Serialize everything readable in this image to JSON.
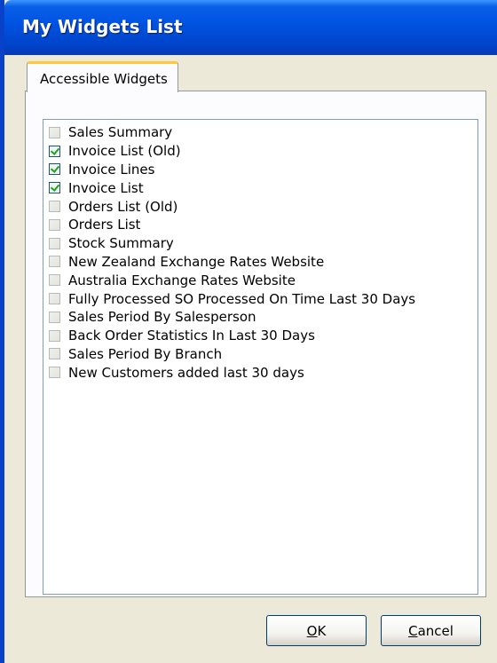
{
  "window": {
    "title": "My Widgets List"
  },
  "tabs": [
    {
      "label": "Accessible Widgets"
    }
  ],
  "widgets": [
    {
      "label": "Sales Summary",
      "checked": false
    },
    {
      "label": "Invoice List (Old)",
      "checked": true
    },
    {
      "label": "Invoice Lines",
      "checked": true
    },
    {
      "label": "Invoice List",
      "checked": true
    },
    {
      "label": "Orders List (Old)",
      "checked": false
    },
    {
      "label": "Orders List",
      "checked": false
    },
    {
      "label": "Stock Summary",
      "checked": false
    },
    {
      "label": "New Zealand Exchange Rates Website",
      "checked": false
    },
    {
      "label": "Australia Exchange Rates Website",
      "checked": false
    },
    {
      "label": "Fully Processed SO Processed On Time Last 30 Days",
      "checked": false
    },
    {
      "label": "Sales Period By Salesperson",
      "checked": false
    },
    {
      "label": "Back Order Statistics In Last 30 Days",
      "checked": false
    },
    {
      "label": "Sales Period By Branch",
      "checked": false
    },
    {
      "label": "New Customers added last 30 days",
      "checked": false
    }
  ],
  "buttons": {
    "ok": {
      "mnemonic": "O",
      "rest": "K"
    },
    "cancel": {
      "mnemonic": "C",
      "rest": "ancel"
    }
  },
  "colors": {
    "titlebar": "#0054e3",
    "tab_highlight": "#ffc83c",
    "check": "#21a121"
  }
}
